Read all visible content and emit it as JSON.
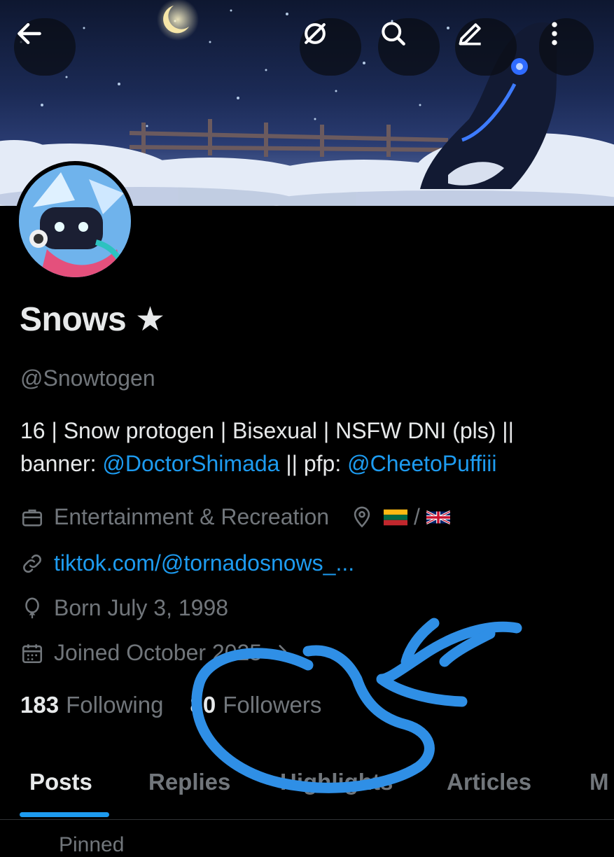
{
  "header": {
    "back_icon": "arrow-left-icon",
    "grok_icon": "circle-slash-icon",
    "search_icon": "search-icon",
    "edit_icon": "pencil-icon",
    "more_icon": "more-vertical-icon"
  },
  "profile": {
    "name": "Snows ★",
    "handle": "@Snowtogen",
    "bio_line1": "16 | Snow protogen  | Bisexual | NSFW DNI (pls) ||",
    "bio_prefix2": "banner: ",
    "bio_mention1": "@DoctorShimada",
    "bio_mid2": " || pfp: ",
    "bio_mention2": "@CheetoPuffiii",
    "category": "Entertainment & Recreation",
    "location_separator": " / ",
    "link": "tiktok.com/@tornadosnows_...",
    "born": "Born July 3, 1998",
    "joined": "Joined October 2025",
    "following_count": "183",
    "following_label": "Following",
    "followers_count": "80",
    "followers_label": "Followers"
  },
  "tabs": [
    {
      "label": "Posts",
      "active": true
    },
    {
      "label": "Replies"
    },
    {
      "label": "Highlights"
    },
    {
      "label": "Articles"
    },
    {
      "label": "M"
    }
  ],
  "pinned_label": "Pinned",
  "colors": {
    "accent": "#1d9bf0",
    "background": "#000000",
    "muted_text": "#71767b",
    "primary_text": "#e7e9ea"
  }
}
